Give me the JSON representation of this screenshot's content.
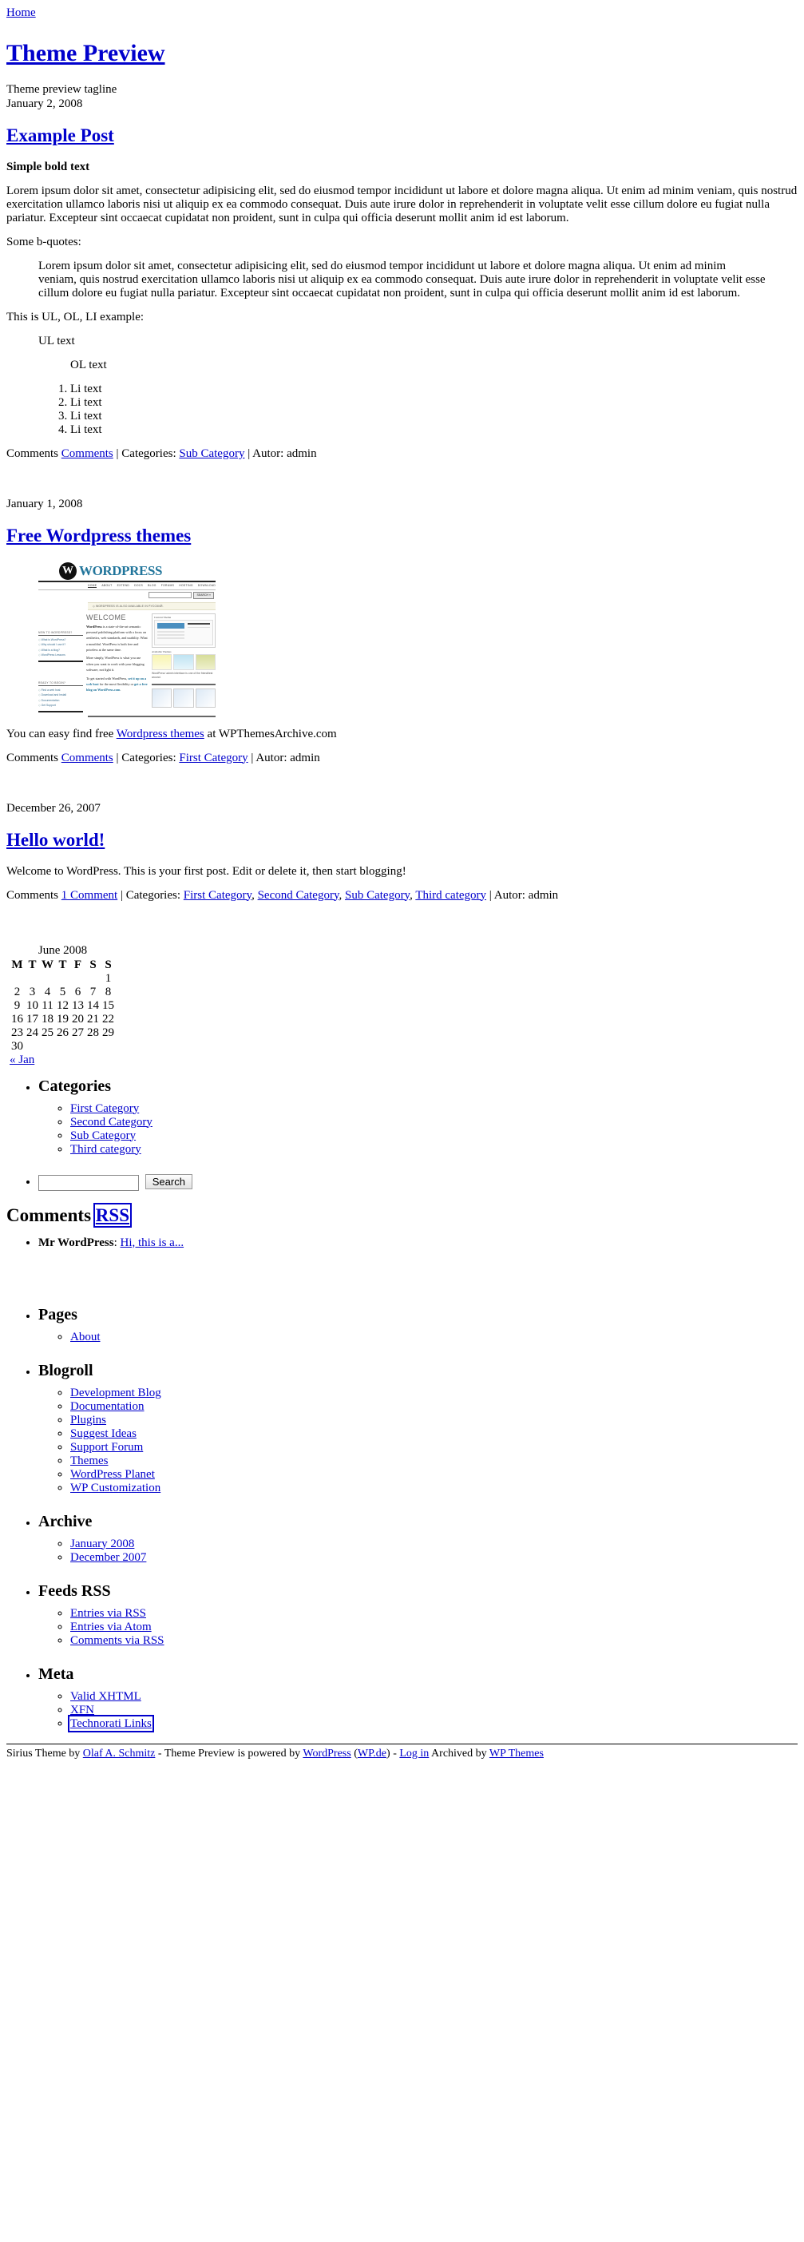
{
  "nav": {
    "home": "Home"
  },
  "site": {
    "title": "Theme Preview",
    "tagline": "Theme preview tagline",
    "date": "January 2, 2008"
  },
  "posts": [
    {
      "title": "Example Post",
      "bold_text": "Simple bold text",
      "paragraph": "Lorem ipsum dolor sit amet, consectetur adipisicing elit, sed do eiusmod tempor incididunt ut labore et dolore magna aliqua. Ut enim ad minim veniam, quis nostrud exercitation ullamco laboris nisi ut aliquip ex ea commodo consequat. Duis aute irure dolor in reprehenderit in voluptate velit esse cillum dolore eu fugiat nulla pariatur. Excepteur sint occaecat cupidatat non proident, sunt in culpa qui officia deserunt mollit anim id est laborum.",
      "bquote_intro": "Some b-quotes:",
      "blockquote": "Lorem ipsum dolor sit amet, consectetur adipisicing elit, sed do eiusmod tempor incididunt ut labore et dolore magna aliqua. Ut enim ad minim veniam, quis nostrud exercitation ullamco laboris nisi ut aliquip ex ea commodo consequat. Duis aute irure dolor in reprehenderit in voluptate velit esse cillum dolore eu fugiat nulla pariatur. Excepteur sint occaecat cupidatat non proident, sunt in culpa qui officia deserunt mollit anim id est laborum.",
      "list_intro": "This is UL, OL, LI example:",
      "ul_text": "UL text",
      "ol_text": "OL text",
      "li_items": [
        "Li text",
        "Li text",
        "Li text",
        "Li text"
      ],
      "meta": {
        "comments_label": "Comments",
        "comments_link": "Comments",
        "sep": "|",
        "categories_label": "Categories:",
        "categories": [
          "Sub Category"
        ],
        "author_label": "Autor:",
        "author": "admin"
      }
    },
    {
      "date": "January 1, 2008",
      "title": "Free Wordpress themes",
      "caption_before": "You can easy find free ",
      "caption_link": "Wordpress themes",
      "caption_after": " at WPThemesArchive.com",
      "meta": {
        "comments_label": "Comments",
        "comments_link": "Comments",
        "sep": "|",
        "categories_label": "Categories:",
        "categories": [
          "First Category"
        ],
        "author_label": "Autor:",
        "author": "admin"
      }
    },
    {
      "date": "December 26, 2007",
      "title": "Hello world!",
      "body": "Welcome to WordPress. This is your first post. Edit or delete it, then start blogging!",
      "meta": {
        "comments_label": "Comments",
        "comments_link": "1 Comment",
        "sep": "|",
        "categories_label": "Categories:",
        "categories": [
          "First Category",
          "Second Category",
          "Sub Category",
          "Third category"
        ],
        "author_label": "Autor:",
        "author": "admin"
      }
    }
  ],
  "wp_screenshot": {
    "wordmark": "WORDPRESS",
    "nav": [
      "HOME",
      "ABOUT",
      "EXTEND",
      "DOCS",
      "BLOG",
      "FORUMS",
      "HOSTING",
      "DOWNLOAD"
    ],
    "search_button": "SEARCH »",
    "banner": "◇ WORDPRESS IS ALSO AVAILABLE IN РУССКИЙ.",
    "left_heading_1": "NEW TO WORDPRESS?",
    "left_links_1": [
      "What is WordPress?",
      "Why should I use it?",
      "What is a blog?",
      "WordPress Lessons"
    ],
    "left_heading_2": "READY TO BEGIN?",
    "left_links_2": [
      "Find a web host",
      "Download and Install",
      "Documentation",
      "Get Support"
    ],
    "welcome": "WELCOME",
    "para_1_bold": "WordPress",
    "para_1": " is a state-of-the-art semantic personal publishing platform with a focus on aesthetics, web standards, and usability. What a mouthful. WordPress is both free and priceless at the same time.",
    "para_2": "More simply, WordPress is what you use when you want to work with your blogging software, not fight it.",
    "para_3_a": "To get started with WordPress, ",
    "para_3_b": "set it up on a web host",
    "para_3_c": " for the most flexibility or ",
    "para_3_d": "get a free blog on WordPress.com",
    "para_3_e": ".",
    "current_theme": "Current Theme",
    "theme_name": "WordPress Default 1.5 by Michael Heilemann",
    "theme_desc": "The default WordPress theme based on the famous",
    "available_themes": "Available Themes",
    "theme_captions": [
      "Minimal Spring 1.0",
      "Blix 2.3.2",
      "Cu"
    ],
    "admin_caption": "WordPress' admin interface is one of the friendliest around."
  },
  "calendar": {
    "caption": "June 2008",
    "day_headers": [
      "M",
      "T",
      "W",
      "T",
      "F",
      "S",
      "S"
    ],
    "weeks": [
      [
        "",
        "",
        "",
        "",
        "",
        "",
        "1"
      ],
      [
        "2",
        "3",
        "4",
        "5",
        "6",
        "7",
        "8"
      ],
      [
        "9",
        "10",
        "11",
        "12",
        "13",
        "14",
        "15"
      ],
      [
        "16",
        "17",
        "18",
        "19",
        "20",
        "21",
        "22"
      ],
      [
        "23",
        "24",
        "25",
        "26",
        "27",
        "28",
        "29"
      ],
      [
        "30",
        "",
        "",
        "",
        "",
        "",
        ""
      ]
    ],
    "prev_link": "« Jan"
  },
  "sidebar": {
    "categories": {
      "heading": "Categories",
      "items": [
        "First Category",
        "Second Category",
        "Sub Category",
        "Third category"
      ]
    },
    "search": {
      "value": "",
      "placeholder": "",
      "button": "Search"
    },
    "comments": {
      "heading": "Comments",
      "rss_label": "RSS",
      "items": [
        {
          "author": "Mr WordPress",
          "sep": ": ",
          "excerpt": "Hi, this is a..."
        }
      ]
    },
    "pages": {
      "heading": "Pages",
      "items": [
        "About"
      ]
    },
    "blogroll": {
      "heading": "Blogroll",
      "items": [
        "Development Blog",
        "Documentation",
        "Plugins",
        "Suggest Ideas",
        "Support Forum",
        "Themes",
        "WordPress Planet",
        "WP Customization"
      ]
    },
    "archive": {
      "heading": "Archive",
      "items": [
        "January 2008",
        "December 2007"
      ]
    },
    "feeds": {
      "heading": "Feeds RSS",
      "items": [
        "Entries via RSS",
        "Entries via Atom",
        "Comments via RSS"
      ]
    },
    "meta": {
      "heading": "Meta",
      "items": [
        "Valid XHTML",
        "XFN",
        "Technorati Links"
      ],
      "focused_item": "Technorati Links"
    }
  },
  "footer": {
    "a": "Sirius Theme by ",
    "author": "Olaf A. Schmitz",
    "b": " - Theme Preview is powered by ",
    "wordpress": "WordPress",
    "c": " (",
    "wpde": "WP.de",
    "d": ") - ",
    "login": "Log in",
    "e": " Archived by ",
    "wpthemes": "WP Themes"
  },
  "colors": {
    "link": "#0000cc",
    "text": "#000000",
    "background": "#ffffff"
  }
}
